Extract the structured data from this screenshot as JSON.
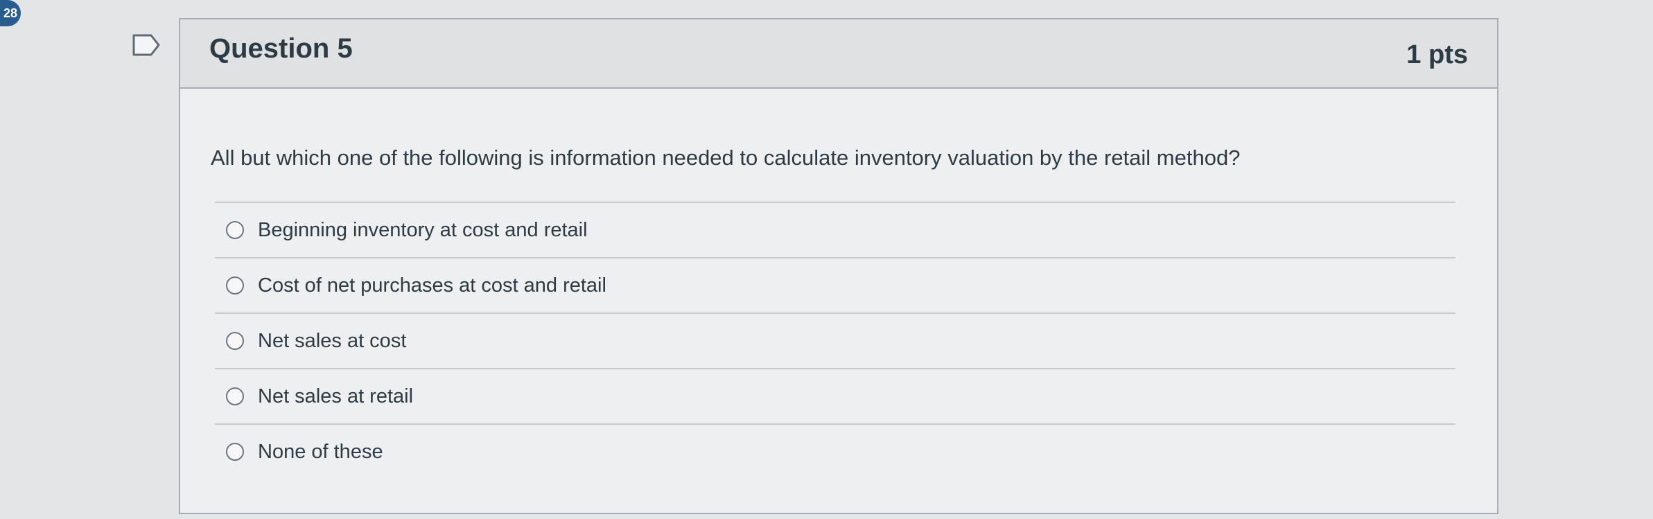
{
  "question_number_badge": "28",
  "question": {
    "title": "Question 5",
    "points": "1 pts",
    "text": "All but which one of the following is information needed to calculate inventory valuation by the retail method?",
    "answers": [
      {
        "label": "Beginning inventory at cost and retail",
        "selected": false
      },
      {
        "label": "Cost of net purchases at cost and retail",
        "selected": false
      },
      {
        "label": "Net sales at cost",
        "selected": false
      },
      {
        "label": "Net sales at retail",
        "selected": false
      },
      {
        "label": "None of these",
        "selected": false
      }
    ]
  },
  "icons": {
    "flag": "flag-icon"
  },
  "colors": {
    "badge": "#2a5d8f",
    "text": "#2d3b45",
    "header_bg": "#dfe1e3",
    "border": "#a7adb2"
  }
}
